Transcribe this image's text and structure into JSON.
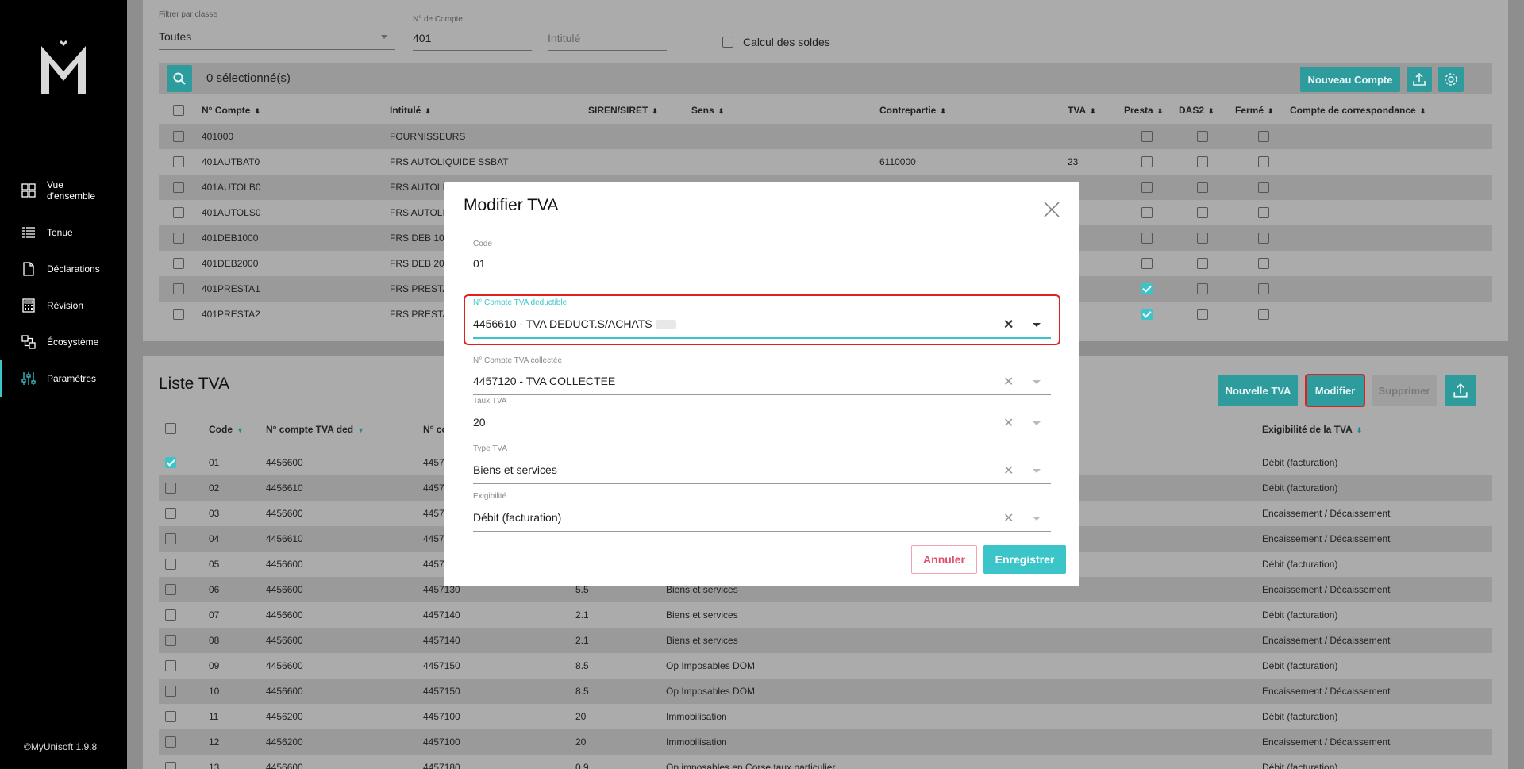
{
  "sidebar": {
    "nav": [
      {
        "label": "Vue d'ensemble",
        "line1": "Vue",
        "line2": "d'ensemble",
        "icon": "dashboard-icon"
      },
      {
        "label": "Tenue",
        "icon": "list-icon"
      },
      {
        "label": "Déclarations",
        "icon": "document-icon"
      },
      {
        "label": "Révision",
        "icon": "calculator-icon"
      },
      {
        "label": "Écosystème",
        "icon": "ecosystem-icon"
      },
      {
        "label": "Paramètres",
        "icon": "sliders-icon"
      }
    ],
    "version": "©MyUnisoft 1.9.8"
  },
  "accounts": {
    "filter_class_label": "Filtrer par classe",
    "filter_class_value": "Toutes",
    "account_no_label": "N° de Compte",
    "account_no_value": "401",
    "intitule_placeholder": "Intitulé",
    "calc_soldes_label": "Calcul des soldes",
    "selected_text": "0 sélectionné(s)",
    "new_account_button": "Nouveau Compte",
    "columns": [
      "N° Compte",
      "Intitulé",
      "SIREN/SIRET",
      "Sens",
      "Contrepartie",
      "TVA",
      "Presta",
      "DAS2",
      "Fermé",
      "Compte de correspondance"
    ],
    "rows": [
      {
        "num": "401000",
        "intitule": "FOURNISSEURS",
        "contrepartie": "",
        "tva": "",
        "presta": false
      },
      {
        "num": "401AUTBAT0",
        "intitule": "FRS AUTOLIQUIDE SSBAT",
        "contrepartie": "6110000",
        "tva": "23",
        "presta": false
      },
      {
        "num": "401AUTOLB0",
        "intitule": "FRS AUTOLI",
        "contrepartie": "",
        "tva": "",
        "presta": false
      },
      {
        "num": "401AUTOLS0",
        "intitule": "FRS AUTOLI",
        "contrepartie": "",
        "tva": "",
        "presta": false
      },
      {
        "num": "401DEB1000",
        "intitule": "FRS DEB 10",
        "contrepartie": "",
        "tva": "",
        "presta": false
      },
      {
        "num": "401DEB2000",
        "intitule": "FRS DEB 20",
        "contrepartie": "",
        "tva": "",
        "presta": false
      },
      {
        "num": "401PRESTA1",
        "intitule": "FRS PRESTA",
        "contrepartie": "",
        "tva": "",
        "presta": true
      },
      {
        "num": "401PRESTA2",
        "intitule": "FRS PRESTA",
        "contrepartie": "",
        "tva": "",
        "presta": true
      }
    ]
  },
  "tva_list": {
    "title": "Liste TVA",
    "buttons": {
      "new": "Nouvelle TVA",
      "modify": "Modifier",
      "delete": "Supprimer"
    },
    "columns": [
      "Code",
      "N° compte TVA ded",
      "N° co",
      "Exigibilité de la TVA"
    ],
    "rows": [
      {
        "code": "01",
        "ded": "4456600",
        "col": "4457",
        "taux": "",
        "type": "",
        "exig": "Débit (facturation)",
        "checked": true
      },
      {
        "code": "02",
        "ded": "4456610",
        "col": "4457",
        "taux": "",
        "type": "",
        "exig": "Débit (facturation)",
        "checked": false
      },
      {
        "code": "03",
        "ded": "4456600",
        "col": "4457",
        "taux": "",
        "type": "",
        "exig": "Encaissement / Décaissement",
        "checked": false
      },
      {
        "code": "04",
        "ded": "4456610",
        "col": "4457",
        "taux": "",
        "type": "",
        "exig": "Encaissement / Décaissement",
        "checked": false
      },
      {
        "code": "05",
        "ded": "4456600",
        "col": "4457",
        "taux": "",
        "type": "",
        "exig": "Débit (facturation)",
        "checked": false
      },
      {
        "code": "06",
        "ded": "4456600",
        "col": "4457130",
        "taux": "5.5",
        "type": "Biens et services",
        "exig": "Encaissement / Décaissement",
        "checked": false
      },
      {
        "code": "07",
        "ded": "4456600",
        "col": "4457140",
        "taux": "2.1",
        "type": "Biens et services",
        "exig": "Débit (facturation)",
        "checked": false
      },
      {
        "code": "08",
        "ded": "4456600",
        "col": "4457140",
        "taux": "2.1",
        "type": "Biens et services",
        "exig": "Encaissement / Décaissement",
        "checked": false
      },
      {
        "code": "09",
        "ded": "4456600",
        "col": "4457150",
        "taux": "8.5",
        "type": "Op Imposables DOM",
        "exig": "Débit (facturation)",
        "checked": false
      },
      {
        "code": "10",
        "ded": "4456600",
        "col": "4457150",
        "taux": "8.5",
        "type": "Op Imposables DOM",
        "exig": "Encaissement / Décaissement",
        "checked": false
      },
      {
        "code": "11",
        "ded": "4456200",
        "col": "4457100",
        "taux": "20",
        "type": "Immobilisation",
        "exig": "Débit (facturation)",
        "checked": false
      },
      {
        "code": "12",
        "ded": "4456200",
        "col": "4457100",
        "taux": "20",
        "type": "Immobilisation",
        "exig": "Encaissement / Décaissement",
        "checked": false
      },
      {
        "code": "13",
        "ded": "4456600",
        "col": "4457180",
        "taux": "0.9",
        "type": "Op imposables en Corse taux particulier",
        "exig": "Débit (facturation)",
        "checked": false
      }
    ]
  },
  "modal": {
    "title": "Modifier TVA",
    "code_label": "Code",
    "code_value": "01",
    "ded_label": "N° Compte TVA deductible",
    "ded_value": "4456610 - TVA DEDUCT.S/ACHATS",
    "col_label": "N° Compte TVA collectée",
    "col_value": "4457120 - TVA COLLECTEE",
    "taux_label": "Taux TVA",
    "taux_value": "20",
    "type_label": "Type TVA",
    "type_value": "Biens et services",
    "exig_label": "Exigibilité",
    "exig_value": "Débit (facturation)",
    "cancel": "Annuler",
    "save": "Enregistrer"
  },
  "colors": {
    "accent": "#3cc5c8",
    "highlight": "#e02020",
    "sidebar_bg": "#000000"
  }
}
